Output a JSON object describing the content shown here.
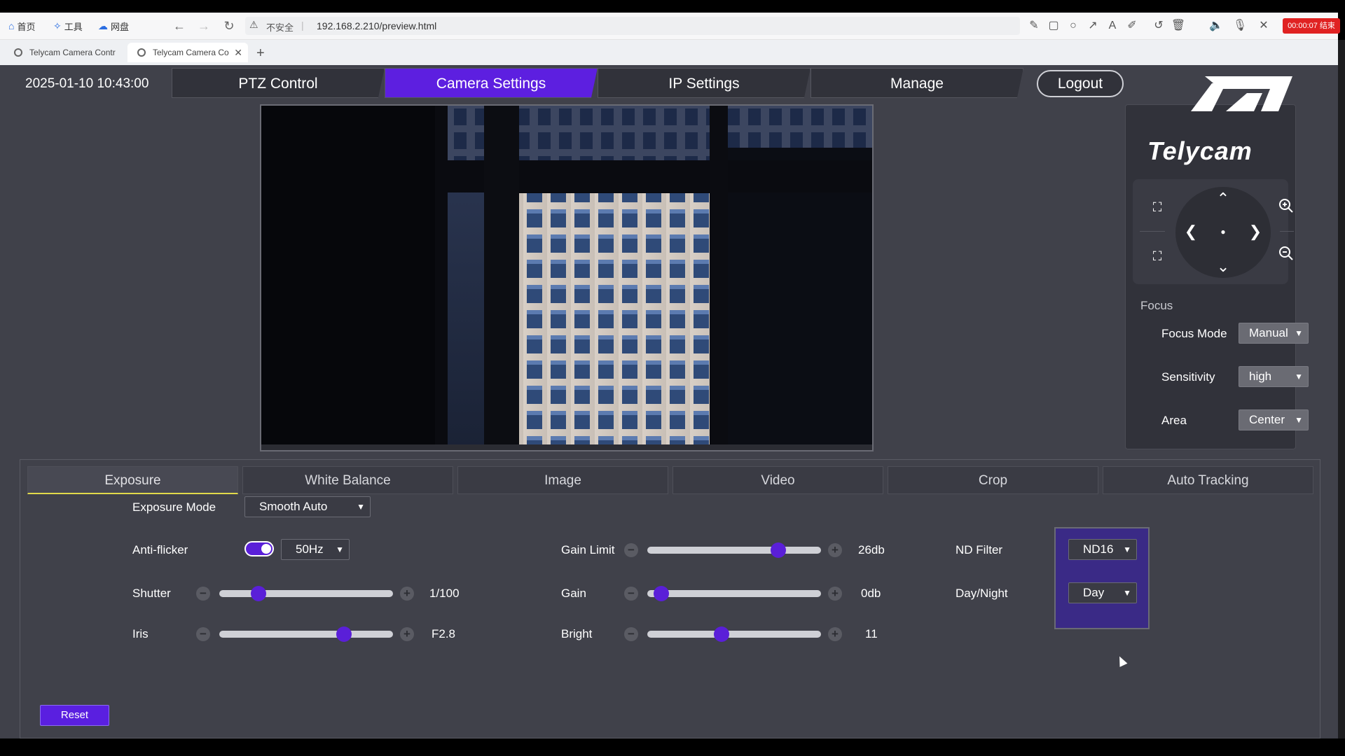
{
  "browser": {
    "toolbar_left": [
      {
        "label": "首页",
        "icon": "home-icon"
      },
      {
        "label": "工具",
        "icon": "tools-icon"
      },
      {
        "label": "网盘",
        "icon": "cloud-icon"
      }
    ],
    "security": "不安全",
    "url": "192.168.2.210/preview.html",
    "recording": "00:00:07 结束",
    "tabs": [
      {
        "title": "Telycam Camera Contr"
      },
      {
        "title": "Telycam Camera Co"
      }
    ]
  },
  "app": {
    "datetime": "2025-01-10 10:43:00",
    "nav": {
      "ptz": "PTZ Control",
      "camera": "Camera Settings",
      "ip": "IP Settings",
      "manage": "Manage",
      "logout": "Logout"
    },
    "brand": "Telycam",
    "accent_color": "#5d1fe0",
    "focus": {
      "title": "Focus",
      "mode_label": "Focus Mode",
      "mode_value": "Manual",
      "sensitivity_label": "Sensitivity",
      "sensitivity_value": "high",
      "area_label": "Area",
      "area_value": "Center"
    },
    "settings_tabs": [
      "Exposure",
      "White Balance",
      "Image",
      "Video",
      "Crop",
      "Auto Tracking"
    ],
    "exposure": {
      "mode_label": "Exposure Mode",
      "mode_value": "Smooth Auto",
      "antiflicker_label": "Anti-flicker",
      "antiflicker_on": true,
      "antiflicker_value": "50Hz",
      "shutter_label": "Shutter",
      "shutter_value": "1/100",
      "shutter_level": 0.2,
      "iris_label": "Iris",
      "iris_value": "F2.8",
      "iris_level": 0.74,
      "gainlimit_label": "Gain Limit",
      "gainlimit_value": "26db",
      "gainlimit_level": 0.78,
      "gain_label": "Gain",
      "gain_value": "0db",
      "gain_level": 0.04,
      "bright_label": "Bright",
      "bright_value": "11",
      "bright_level": 0.42,
      "nd_label": "ND Filter",
      "nd_value": "ND16",
      "daynight_label": "Day/Night",
      "daynight_value": "Day",
      "reset": "Reset"
    }
  }
}
